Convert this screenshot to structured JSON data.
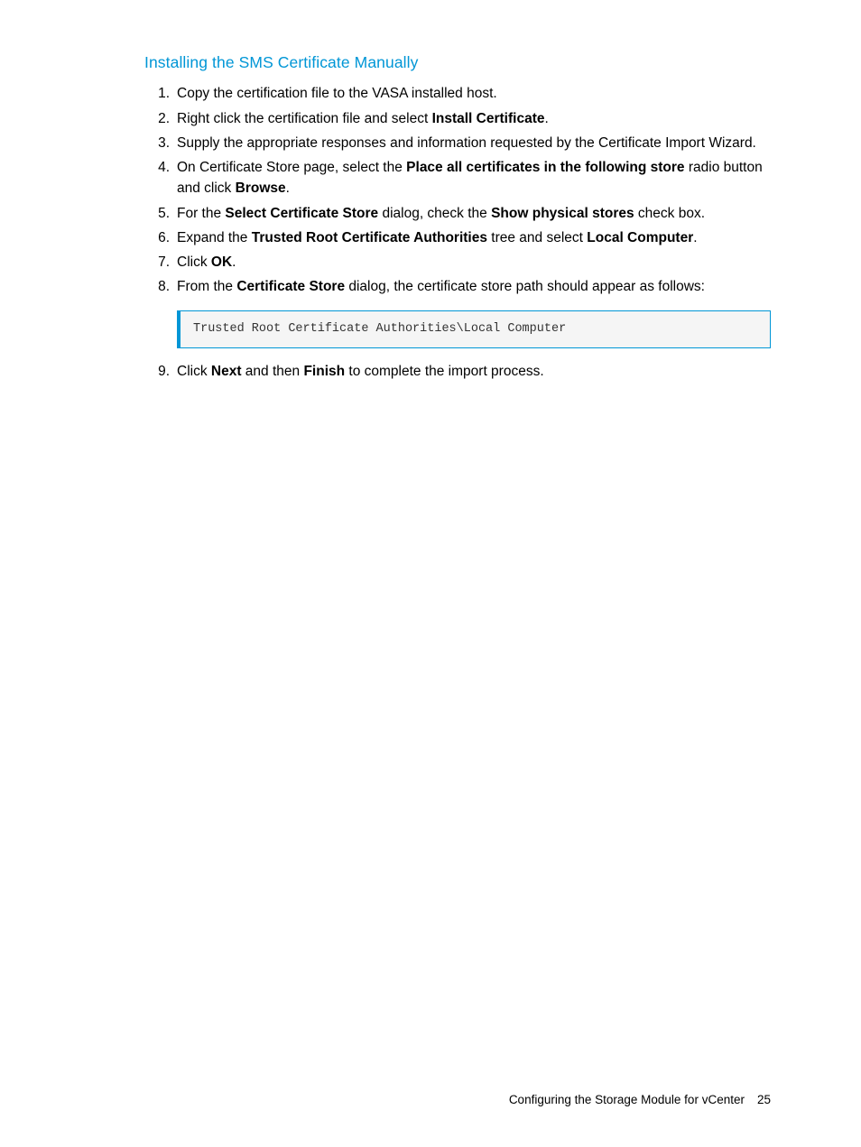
{
  "heading": "Installing the SMS Certificate Manually",
  "steps": {
    "s1": {
      "t1": "Copy the certification file to the VASA installed host."
    },
    "s2": {
      "t1": "Right click the certification file and select ",
      "b1": "Install Certificate",
      "t2": "."
    },
    "s3": {
      "t1": "Supply the appropriate responses and information requested by the Certificate Import Wizard."
    },
    "s4": {
      "t1": "On Certificate Store page, select the ",
      "b1": "Place all certificates in the following store",
      "t2": " radio button and click ",
      "b2": "Browse",
      "t3": "."
    },
    "s5": {
      "t1": "For the ",
      "b1": "Select Certificate Store",
      "t2": " dialog, check the ",
      "b2": "Show physical stores",
      "t3": " check box."
    },
    "s6": {
      "t1": "Expand the ",
      "b1": "Trusted Root Certificate Authorities",
      "t2": " tree and select ",
      "b2": "Local Computer",
      "t3": "."
    },
    "s7": {
      "t1": "Click ",
      "b1": "OK",
      "t2": "."
    },
    "s8": {
      "t1": "From the ",
      "b1": "Certificate Store",
      "t2": " dialog, the certificate store path should appear as follows:"
    },
    "code": "Trusted Root Certificate Authorities\\Local Computer",
    "s9": {
      "t1": "Click ",
      "b1": "Next",
      "t2": " and then ",
      "b2": "Finish",
      "t3": " to complete the import process."
    }
  },
  "footer": {
    "text": "Configuring the Storage Module for vCenter",
    "page": "25"
  }
}
